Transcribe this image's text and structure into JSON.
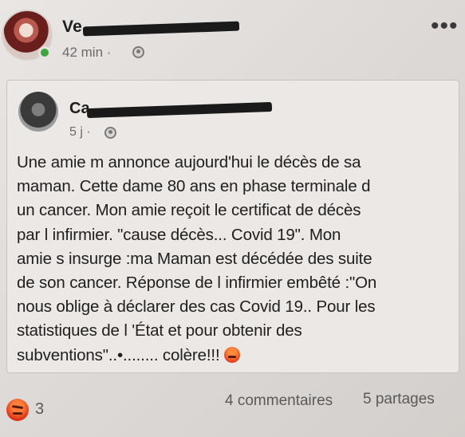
{
  "post": {
    "author": "Ve",
    "time": "42 min ·",
    "more_glyph": "•••"
  },
  "shared": {
    "author": "Ca",
    "time": "5 j ·",
    "text_lines": [
      "Une amie m annonce aujourd'hui le décès de sa",
      "maman. Cette dame 80 ans en phase terminale d",
      "un cancer. Mon amie reçoit le certificat de décès",
      "par l infirmier. \"cause décès... Covid 19\". Mon",
      "amie s insurge :ma Maman est décédée des suite",
      "de son cancer. Réponse de l infirmier embêté :\"On",
      "nous oblige à déclarer des cas Covid 19.. Pour les",
      "statistiques de l 'État et pour obtenir des",
      "subventions\"..•........  colère!!!"
    ]
  },
  "footer": {
    "reaction_count": "3",
    "comments": "4 commentaires",
    "shares": "5 partages"
  },
  "colors": {
    "background": "#e2dedb",
    "online_status": "#3fa53f",
    "angry_reaction": "#e8421f"
  },
  "icons": [
    "avatar",
    "online-status-icon",
    "globe-icon",
    "more-options-icon",
    "angry-reaction-icon"
  ]
}
